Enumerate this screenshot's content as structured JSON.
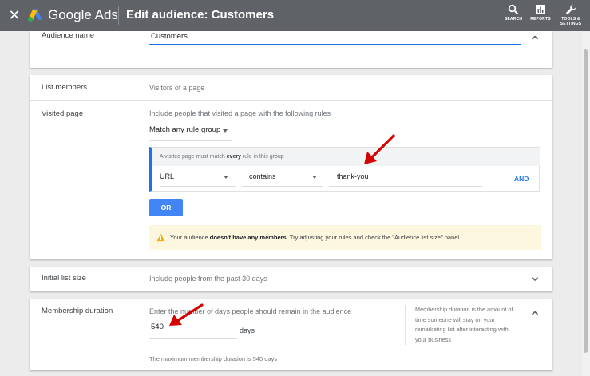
{
  "header": {
    "close_glyph": "✕",
    "brand": "Google Ads",
    "title": "Edit audience: Customers",
    "tools": [
      {
        "label": "SEARCH",
        "icon": "search-icon"
      },
      {
        "label": "REPORTS",
        "icon": "reports-icon"
      },
      {
        "label": "TOOLS & SETTINGS",
        "icon": "wrench-icon"
      }
    ]
  },
  "audience_name": {
    "label": "Audience name",
    "value": "Customers"
  },
  "list_members": {
    "label": "List members",
    "value": "Visitors of a page"
  },
  "visited_page": {
    "label": "Visited page",
    "description": "Include people that visited a page with the following rules",
    "match_select": "Match any rule group",
    "rule_group": {
      "hint_prefix": "A visited page must match ",
      "hint_bold": "every",
      "hint_suffix": " rule in this group",
      "field": "URL",
      "operator": "contains",
      "value": "thank-you",
      "and_label": "AND"
    },
    "or_label": "OR",
    "warning": {
      "prefix": "Your audience ",
      "bold": "doesn't have any members",
      "suffix": ". Try adjusting your rules and check the \"Audience list size\" panel."
    }
  },
  "initial_list_size": {
    "label": "Initial list size",
    "value": "Include people from the past 30 days"
  },
  "membership_duration": {
    "label": "Membership duration",
    "description": "Enter the number of days people should remain in the audience",
    "days_value": "540",
    "days_unit": "days",
    "max_note": "The maximum membership duration is 540 days",
    "help": "Membership duration is the amount of time someone will stay on your remarketing list after interacting with your business"
  },
  "colors": {
    "header_bg": "#5f6368",
    "accent_blue": "#1a73e8",
    "button_blue": "#4285f4",
    "warning_bg": "#fef7e0",
    "warning_icon": "#f9ab00",
    "annotation_arrow": "#d50000"
  }
}
